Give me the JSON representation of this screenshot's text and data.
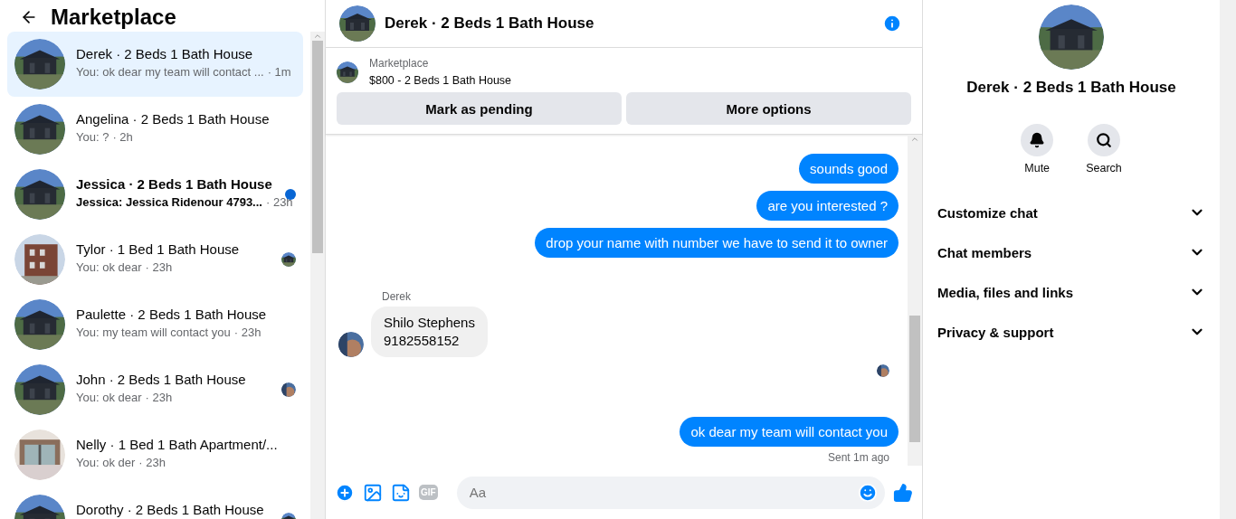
{
  "sidebar": {
    "title": "Marketplace",
    "conversations": [
      {
        "name": "Derek · 2 Beds 1 Bath House",
        "preview": "You: ok dear my team will contact ...",
        "time": "· 1m",
        "selected": true,
        "unread": false,
        "seen": false
      },
      {
        "name": "Angelina · 2 Beds 1 Bath House",
        "preview": "You: ?",
        "time": "· 2h",
        "selected": false,
        "unread": false,
        "seen": false
      },
      {
        "name": "Jessica · 2 Beds 1 Bath House",
        "preview": "Jessica: Jessica Ridenour 4793...",
        "time": "· 23h",
        "selected": false,
        "unread": true,
        "seen": false
      },
      {
        "name": "Tylor · 1 Bed 1 Bath House",
        "preview": "You: ok dear",
        "time": "· 23h",
        "selected": false,
        "unread": false,
        "seen": true
      },
      {
        "name": "Paulette · 2 Beds 1 Bath House",
        "preview": "You: my team will contact you",
        "time": "· 23h",
        "selected": false,
        "unread": false,
        "seen": false
      },
      {
        "name": "John · 2 Beds 1 Bath House",
        "preview": "You: ok dear",
        "time": "· 23h",
        "selected": false,
        "unread": false,
        "seen": true
      },
      {
        "name": "Nelly · 1 Bed 1 Bath Apartment/...",
        "preview": "You: ok der",
        "time": "· 23h",
        "selected": false,
        "unread": false,
        "seen": false
      },
      {
        "name": "Dorothy · 2 Beds 1 Bath House",
        "selected": false,
        "unread": false,
        "seen": true
      }
    ]
  },
  "chat": {
    "title": "Derek · 2 Beds 1 Bath House",
    "listing": {
      "source": "Marketplace",
      "item": "$800 - 2 Beds 1 Bath House"
    },
    "buttons": [
      "Mark as pending",
      "More options"
    ],
    "messages": [
      {
        "kind": "outgoing",
        "text": "sounds good"
      },
      {
        "kind": "outgoing",
        "text": "are you interested ?"
      },
      {
        "kind": "outgoing",
        "text": "drop your name with number we have to send it to owner"
      },
      {
        "kind": "incoming",
        "sender": "Derek",
        "lines": [
          "Shilo Stephens",
          "9182558152"
        ]
      },
      {
        "kind": "seen"
      },
      {
        "kind": "outgoing",
        "text": "ok dear my team will contact you",
        "status": "Sent 1m ago"
      }
    ],
    "composer": {
      "placeholder": "Aa",
      "gif_label": "GIF"
    }
  },
  "details": {
    "title": "Derek · 2 Beds 1 Bath House",
    "actions": [
      {
        "label": "Mute"
      },
      {
        "label": "Search"
      }
    ],
    "sections": [
      {
        "label": "Customize chat",
        "expanded": false
      },
      {
        "label": "Chat members",
        "expanded": false
      },
      {
        "label": "Media, files and links",
        "expanded": false
      },
      {
        "label": "Privacy & support",
        "expanded": false
      }
    ]
  }
}
